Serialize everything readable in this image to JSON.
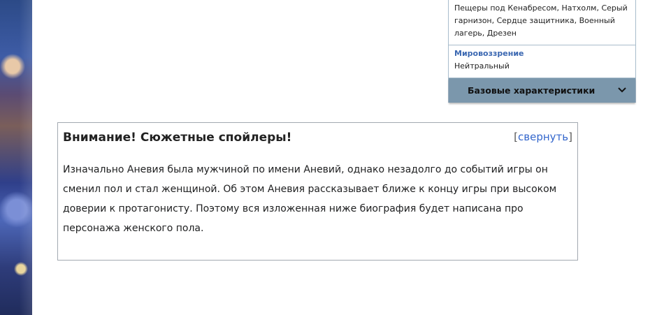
{
  "infobox": {
    "locations_value": "Пещеры под Кенабресом, Натхолм, Серый гарнизон, Сердце защитника, Военный лагерь, Дрезен",
    "alignment_label": "Мировоззрение",
    "alignment_value": "Нейтральный",
    "section_label": "Базовые характеристики",
    "section_icon": "chevron-down-icon"
  },
  "spoiler": {
    "title": "Внимание! Сюжетные спойлеры!",
    "bracket_open": "[",
    "toggle_label": "свернуть",
    "bracket_close": "]",
    "text": "Изначально Аневия была мужчиной по имени Аневий, однако незадолго до событий игры он сменил пол и стал женщиной. Об этом Аневия рассказывает ближе к концу игры при высоком доверии к протагонисту. Поэтому вся изложенная ниже биография будет написана про персонажа женского пола."
  },
  "colors": {
    "link": "#3366cc",
    "infobox_label": "#3a67b1",
    "section_bg": "#7b97ac",
    "border": "#a2a9b1"
  }
}
